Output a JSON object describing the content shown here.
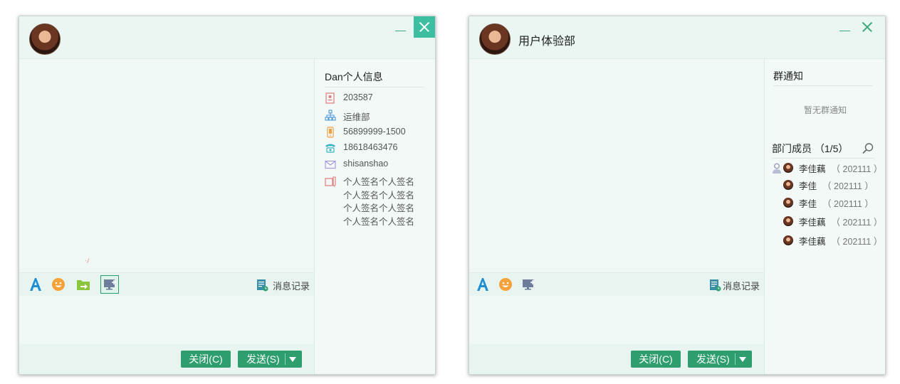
{
  "window1": {
    "contact_name_title": "",
    "profile": {
      "title": "Dan个人信息",
      "employee_id": "203587",
      "department": "运维部",
      "phone": "56899999-1500",
      "mobile": "18618463476",
      "email": "shisanshao",
      "signature": "个人签名个人签名个人签名个人签名个人签名个人签名个人签名个人签名"
    },
    "history_label": "消息记录",
    "close_label": "关闭(C)",
    "send_label": "发送(S)"
  },
  "window2": {
    "title": "用户体验部",
    "notice_title": "群通知",
    "notice_empty": "暂无群通知",
    "members_title": "部门成员 （1/5）",
    "members": [
      {
        "name": "李佳藕",
        "id": "（ 202111 ）"
      },
      {
        "name": "李佳",
        "id": "（ 202111 ）"
      },
      {
        "name": "李佳",
        "id": "（ 202111 ）"
      },
      {
        "name": "李佳藕",
        "id": "（ 202111 ）"
      },
      {
        "name": "李佳藕",
        "id": "（ 202111 ）"
      }
    ],
    "history_label": "消息记录",
    "close_label": "关闭(C)",
    "send_label": "发送(S)"
  },
  "colors": {
    "accent": "#2e9e6e",
    "close_active": "#3bbfa0",
    "window_bg": "#f0f8f6"
  }
}
